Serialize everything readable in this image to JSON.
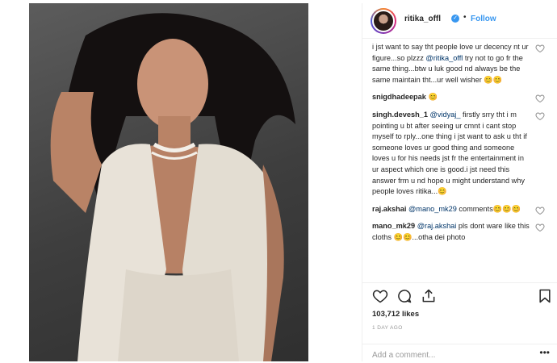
{
  "header": {
    "username": "ritika_offl",
    "separator": "•",
    "follow_label": "Follow"
  },
  "comments": [
    {
      "user": "",
      "parts": [
        {
          "t": "i jst want to say tht people love ur decency nt ur figure...so plzzz ",
          "m": false
        },
        {
          "t": "@ritika_offl",
          "m": true
        },
        {
          "t": " try not to go fr the same thing...btw u luk good nd always be the same maintain tht...ur well wisher 😊😊",
          "m": false
        }
      ]
    },
    {
      "user": "snigdhadeepak",
      "parts": [
        {
          "t": " 😊",
          "m": false
        }
      ]
    },
    {
      "user": "singh.devesh_1",
      "parts": [
        {
          "t": " ",
          "m": false
        },
        {
          "t": "@vidyaj_",
          "m": true
        },
        {
          "t": " firstly srry tht i m pointing u bt after seeing ur cmnt i cant stop myself to rply...one thing i jst want to ask u tht if someone loves ur good thing and someone loves u for his needs jst fr the entertainment in ur aspect which one is good.i jst need this answer frm u nd hope u might understand why people loves ritika...😊",
          "m": false
        }
      ]
    },
    {
      "user": "raj.akshai",
      "parts": [
        {
          "t": " ",
          "m": false
        },
        {
          "t": "@mano_mk29",
          "m": true
        },
        {
          "t": " comments😊😊😊",
          "m": false
        }
      ]
    },
    {
      "user": "mano_mk29",
      "parts": [
        {
          "t": " ",
          "m": false
        },
        {
          "t": "@raj.akshai",
          "m": true
        },
        {
          "t": " pls dont ware like this cloths 😊😊...otha dei photo",
          "m": false
        }
      ]
    }
  ],
  "likes": "103,712 likes",
  "timestamp": "1 DAY AGO",
  "add_comment": {
    "placeholder": "Add a comment..."
  },
  "more_label": "•••",
  "icons": {
    "verified": "verified-badge-icon",
    "like": "heart-icon",
    "comment": "comment-bubble-icon",
    "share": "share-icon",
    "save": "bookmark-icon"
  },
  "colors": {
    "accent": "#3897f0",
    "mention": "#003569",
    "muted": "#999999"
  }
}
